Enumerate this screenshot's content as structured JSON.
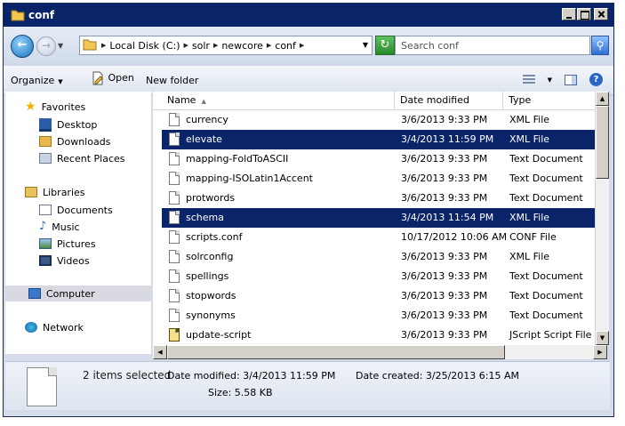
{
  "window": {
    "title": "conf"
  },
  "address": {
    "crumbs": [
      "Local Disk (C:)",
      "solr",
      "newcore",
      "conf"
    ],
    "search_placeholder": "Search conf"
  },
  "toolbar": {
    "organize": "Organize",
    "open": "Open",
    "new_folder": "New folder"
  },
  "nav": {
    "favorites": "Favorites",
    "desktop": "Desktop",
    "downloads": "Downloads",
    "recent": "Recent Places",
    "libraries": "Libraries",
    "documents": "Documents",
    "music": "Music",
    "pictures": "Pictures",
    "videos": "Videos",
    "computer": "Computer",
    "network": "Network"
  },
  "columns": {
    "name": "Name",
    "date": "Date modified",
    "type": "Type"
  },
  "files": [
    {
      "name": "currency",
      "date": "3/6/2013 9:33 PM",
      "type": "XML File",
      "selected": false
    },
    {
      "name": "elevate",
      "date": "3/4/2013 11:59 PM",
      "type": "XML File",
      "selected": true
    },
    {
      "name": "mapping-FoldToASCII",
      "date": "3/6/2013 9:33 PM",
      "type": "Text Document",
      "selected": false
    },
    {
      "name": "mapping-ISOLatin1Accent",
      "date": "3/6/2013 9:33 PM",
      "type": "Text Document",
      "selected": false
    },
    {
      "name": "protwords",
      "date": "3/6/2013 9:33 PM",
      "type": "Text Document",
      "selected": false
    },
    {
      "name": "schema",
      "date": "3/4/2013 11:54 PM",
      "type": "XML File",
      "selected": true
    },
    {
      "name": "scripts.conf",
      "date": "10/17/2012 10:06 AM",
      "type": "CONF File",
      "selected": false
    },
    {
      "name": "solrconfig",
      "date": "3/6/2013 9:33 PM",
      "type": "XML File",
      "selected": false
    },
    {
      "name": "spellings",
      "date": "3/6/2013 9:33 PM",
      "type": "Text Document",
      "selected": false
    },
    {
      "name": "stopwords",
      "date": "3/6/2013 9:33 PM",
      "type": "Text Document",
      "selected": false
    },
    {
      "name": "synonyms",
      "date": "3/6/2013 9:33 PM",
      "type": "Text Document",
      "selected": false
    },
    {
      "name": "update-script",
      "date": "3/6/2013 9:33 PM",
      "type": "JScript Script File",
      "selected": false
    }
  ],
  "details": {
    "selection": "2 items selected",
    "modified": "Date modified: 3/4/2013 11:59 PM",
    "size": "Size: 5.58 KB",
    "created": "Date created: 3/25/2013 6:15 AM"
  }
}
